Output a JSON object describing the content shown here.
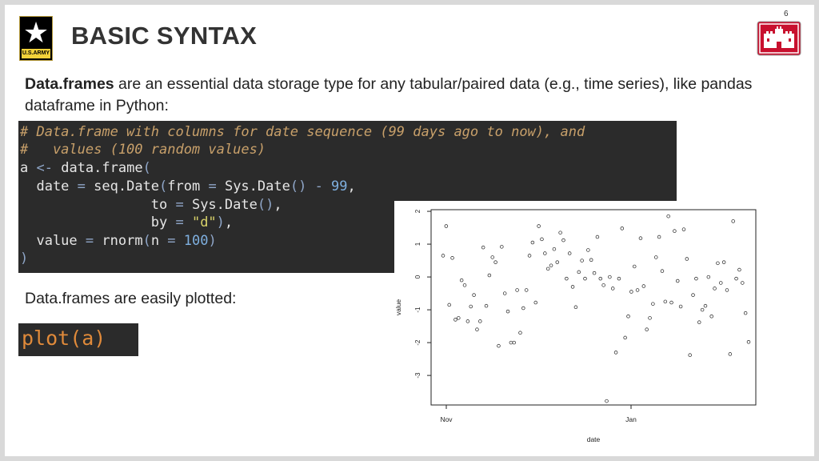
{
  "slide": {
    "page_number": "6",
    "title": "BASIC SYNTAX",
    "army_logo_text": "U.S.ARMY",
    "description_bold": "Data.frames",
    "description_rest": " are an essential data storage type for any tabular/paired data (e.g., time series), like pandas dataframe in Python:",
    "subtitle": "Data.frames are easily plotted:"
  },
  "code": {
    "line1": "# Data.frame with columns for date sequence (99 days ago to now), and",
    "line2": "#   values (100 random values)",
    "line3_a": "a ",
    "line3_op": "<-",
    "line3_b": " data.frame",
    "line3_paren": "(",
    "line4_a": "  date ",
    "line4_eq": "=",
    "line4_b": " seq.Date",
    "line4_p1": "(",
    "line4_c": "from ",
    "line4_eq2": "=",
    "line4_d": " Sys.Date",
    "line4_p2": "()",
    "line4_minus": " - ",
    "line4_num": "99",
    "line4_comma": ",",
    "line5_a": "                to ",
    "line5_eq": "=",
    "line5_b": " Sys.Date",
    "line5_p": "()",
    "line5_comma": ",",
    "line6_a": "                by ",
    "line6_eq": "=",
    "line6_str": " \"d\"",
    "line6_p": ")",
    "line6_comma": ",",
    "line7_a": "  value ",
    "line7_eq": "=",
    "line7_b": " rnorm",
    "line7_p1": "(",
    "line7_c": "n ",
    "line7_eq2": "=",
    "line7_num": " 100",
    "line7_p2": ")",
    "line8": ")",
    "plot_call": "plot(a)"
  },
  "chart_data": {
    "type": "scatter",
    "xlabel": "date",
    "ylabel": "value",
    "x_ticks": [
      "Nov",
      "Jan"
    ],
    "y_ticks": [
      "2",
      "1",
      "0",
      "-1",
      "-2",
      "-3"
    ],
    "ylim": [
      -3.9,
      2.05
    ],
    "x_start": "Nov",
    "grid": false,
    "points_y": [
      0.65,
      1.55,
      -0.85,
      0.58,
      -1.3,
      -1.25,
      -0.1,
      -0.25,
      -1.35,
      -0.9,
      -0.55,
      -1.6,
      -1.35,
      0.9,
      -0.88,
      0.05,
      0.6,
      0.45,
      -2.1,
      0.92,
      -0.5,
      -1.05,
      -2.0,
      -2.0,
      -0.4,
      -1.7,
      -0.95,
      -0.4,
      0.65,
      1.05,
      -0.78,
      1.55,
      1.15,
      0.72,
      0.25,
      0.35,
      0.85,
      0.45,
      1.35,
      1.12,
      -0.05,
      0.72,
      -0.3,
      -0.92,
      0.15,
      0.5,
      -0.05,
      0.82,
      0.52,
      0.12,
      1.22,
      -0.05,
      -0.25,
      -3.78,
      0.0,
      -0.35,
      -2.3,
      -0.05,
      1.48,
      -1.85,
      -1.2,
      -0.45,
      0.32,
      -0.4,
      1.18,
      -0.28,
      -1.6,
      -1.25,
      -0.82,
      0.6,
      1.22,
      0.18,
      -0.75,
      1.85,
      -0.78,
      1.4,
      -0.12,
      -0.9,
      1.45,
      0.55,
      -2.38,
      -0.55,
      -0.05,
      -1.38,
      -1.0,
      -0.88,
      0.0,
      -1.2,
      -0.35,
      0.42,
      -0.18,
      0.45,
      -0.4,
      -2.35,
      1.7,
      -0.05,
      0.22,
      -0.18,
      -1.1,
      -1.98
    ]
  }
}
